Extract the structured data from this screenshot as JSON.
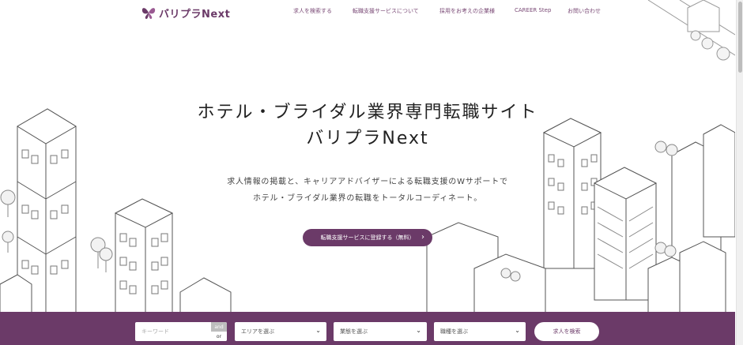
{
  "header": {
    "logo_text": "バリプラNext",
    "nav": [
      {
        "label": "求人を検索する"
      },
      {
        "label": "転職支援サービスについて"
      },
      {
        "label": "採用をお考えの企業様"
      },
      {
        "label": "CAREER Step"
      },
      {
        "label": "お問い合わせ"
      }
    ]
  },
  "hero": {
    "title_line1": "ホテル・ブライダル業界専門転職サイト",
    "title_line2": "バリプラNext",
    "sub_line1": "求人情報の掲載と、キャリアアドバイザーによる転職支援のWサポートで",
    "sub_line2": "ホテル・ブライダル業界の転職をトータルコーディネート。",
    "cta_label": "転職支援サービスに登録する（無料）"
  },
  "search": {
    "keyword_placeholder": "キーワード",
    "and_label": "and",
    "or_label": "or",
    "area_label": "エリアを選ぶ",
    "industry_label": "業態を選ぶ",
    "job_label": "職種を選ぶ",
    "submit_label": "求人を検索"
  },
  "colors": {
    "brand": "#6b3a68",
    "text": "#222222"
  },
  "icons": {
    "logo": "butterfly-logo-icon",
    "cta_arrow": "chevron-right-icon",
    "select_arrow": "chevron-down-icon"
  }
}
